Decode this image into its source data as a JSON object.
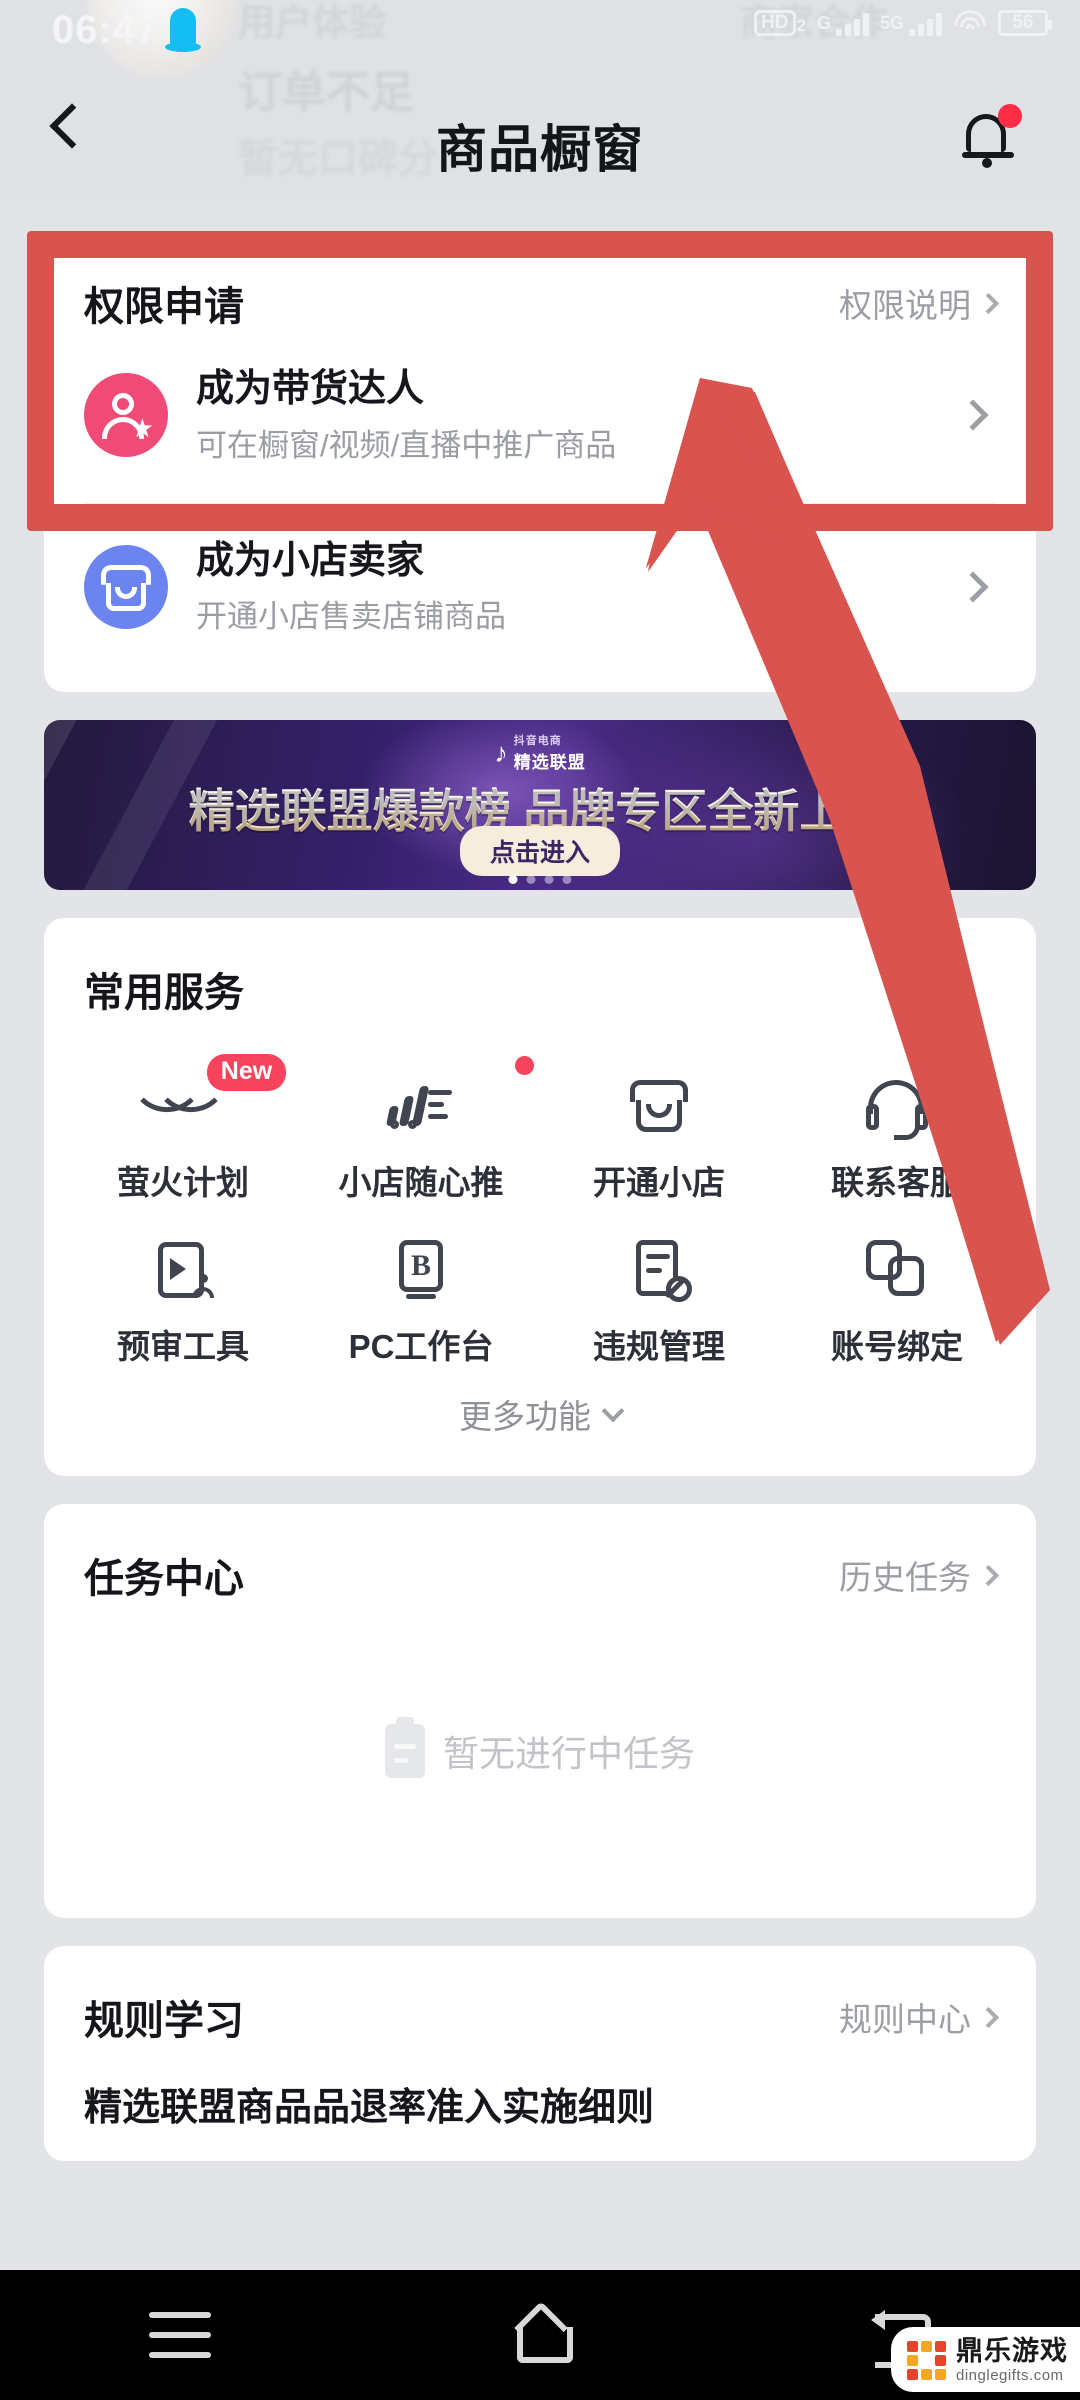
{
  "status_bar": {
    "time": "06:47",
    "hd_label": "HD",
    "hd_sub": "2",
    "sim1_label": "G",
    "sim2_label": "5G",
    "battery": "56",
    "icons": [
      "qq-penguin-icon",
      "hd-voice-icon",
      "signal-bars-icon",
      "wifi-icon",
      "battery-icon"
    ]
  },
  "ghost_background": {
    "user_experience": "用户体验",
    "merchant_cooperation": "商家合作",
    "insufficient_orders": "订单不足",
    "no_reputation_score": "暂无口碑分 ›"
  },
  "header": {
    "title": "商品橱窗",
    "back_icon": "back-chevron-icon",
    "bell_icon": "notification-bell-icon",
    "has_unread": true
  },
  "permission_card": {
    "title": "权限申请",
    "link_label": "权限说明",
    "rows": [
      {
        "name": "成为带货达人",
        "desc": "可在橱窗/视频/直播中推广商品",
        "icon": "person-star-icon",
        "icon_color": "#f04a76"
      },
      {
        "name": "成为小店卖家",
        "desc": "开通小店售卖店铺商品",
        "icon": "shop-icon",
        "icon_color": "#6b84ef"
      }
    ]
  },
  "banner": {
    "brand_small": "抖音电商",
    "brand_big": "精选联盟",
    "title": "精选联盟爆款榜 品牌专区全新上线",
    "button_label": "点击进入",
    "dots_total": 4,
    "dots_active_index": 0
  },
  "services": {
    "title": "常用服务",
    "items": [
      {
        "label": "萤火计划",
        "icon": "heart-check-icon",
        "badge": "New"
      },
      {
        "label": "小店随心推",
        "icon": "promote-chart-icon",
        "dot": true
      },
      {
        "label": "开通小店",
        "icon": "shop-outline-icon"
      },
      {
        "label": "联系客服",
        "icon": "headset-icon"
      },
      {
        "label": "预审工具",
        "icon": "video-review-icon"
      },
      {
        "label": "PC工作台",
        "icon": "pc-workbench-icon"
      },
      {
        "label": "违规管理",
        "icon": "violation-doc-icon"
      },
      {
        "label": "账号绑定",
        "icon": "link-accounts-icon"
      }
    ],
    "more_label": "更多功能",
    "more_icon": "chevron-down-icon"
  },
  "task_center": {
    "title": "任务中心",
    "link_label": "历史任务",
    "empty_text": "暂无进行中任务",
    "empty_icon": "clipboard-empty-icon"
  },
  "rules": {
    "title": "规则学习",
    "link_label": "规则中心",
    "items": [
      "精选联盟商品品退率准入实施细则"
    ]
  },
  "annotation": {
    "highlight_color": "#d9534f",
    "arrow_color": "#d9534f"
  },
  "nav_bar": {
    "menu_icon": "menu-icon",
    "home_icon": "home-icon",
    "back_icon": "back-icon"
  },
  "watermark": {
    "name_cn": "鼎乐游戏",
    "name_en": "dinglegifts.com"
  }
}
